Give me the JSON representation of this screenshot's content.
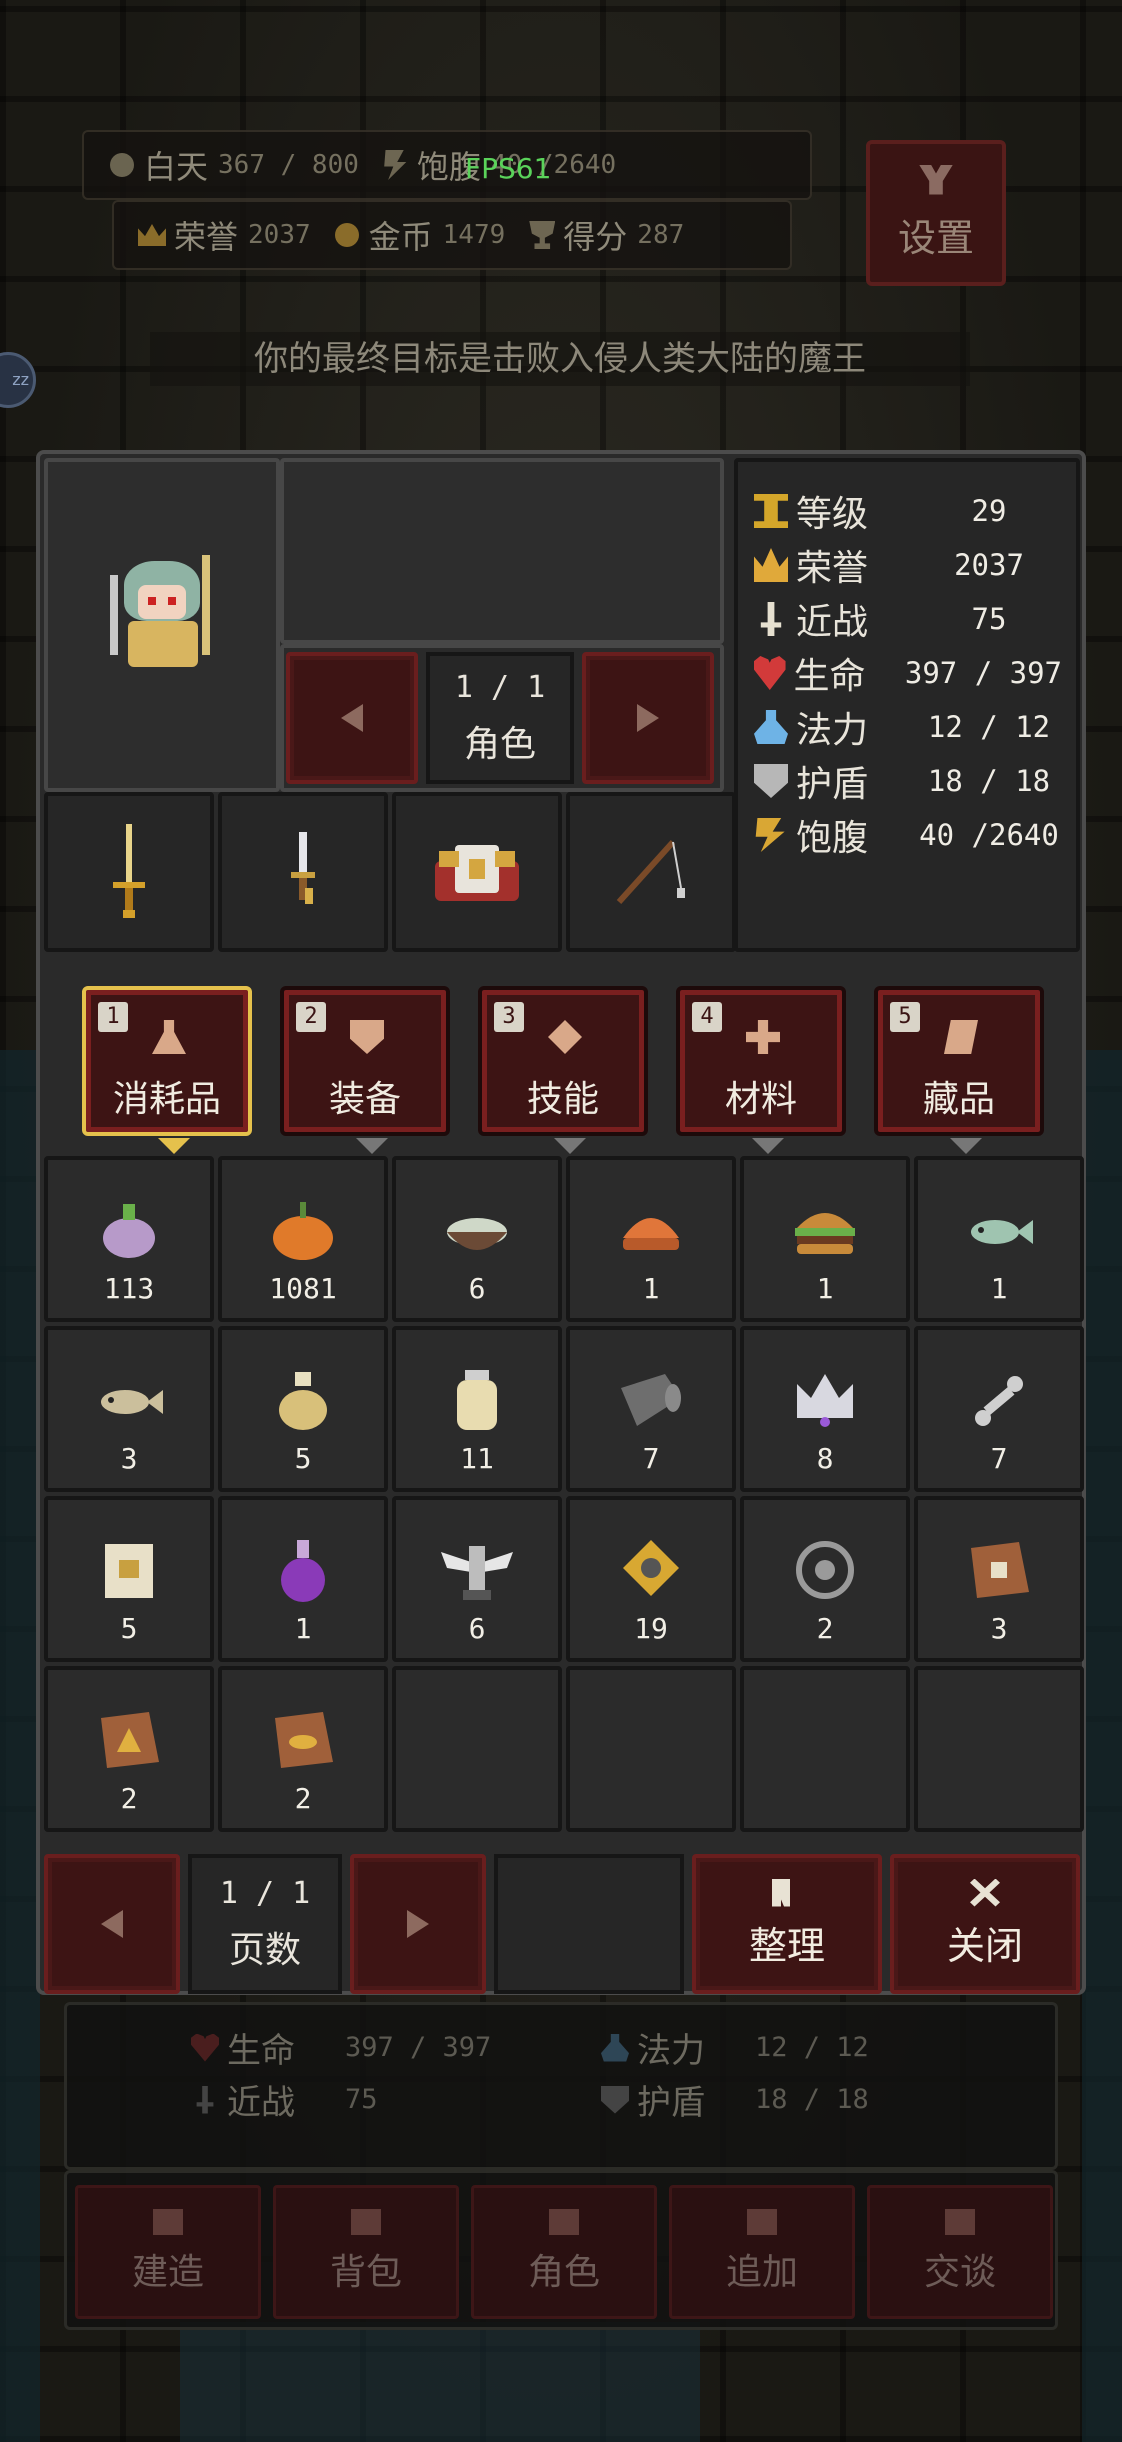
{
  "hud": {
    "day_label": "白天",
    "day_value": "367 / 800",
    "hunger_label": "饱腹",
    "hunger_value": "40 /2640",
    "fps": "FPS61",
    "honor_label": "荣誉",
    "honor_value": "2037",
    "gold_label": "金币",
    "gold_value": "1479",
    "score_label": "得分",
    "score_value": "287",
    "settings_label": "设置",
    "goal_text": "你的最终目标是击败入侵人类大陆的魔王",
    "sleep_badge": "zz"
  },
  "character_panel": {
    "page_indicator": "1  /  1",
    "page_label": "角色",
    "equipment": [
      "golden-sword-icon",
      "dagger-icon",
      "armor-icon",
      "fishing-rod-icon"
    ],
    "stats": [
      {
        "icon": "level-icon",
        "label": "等级",
        "value": "29"
      },
      {
        "icon": "honor-icon",
        "label": "荣誉",
        "value": "2037"
      },
      {
        "icon": "melee-icon",
        "label": "近战",
        "value": "75"
      },
      {
        "icon": "health-icon",
        "label": "生命",
        "value": "397 / 397"
      },
      {
        "icon": "mana-icon",
        "label": "法力",
        "value": "12  /  12"
      },
      {
        "icon": "shield-icon",
        "label": "护盾",
        "value": "18  /  18"
      },
      {
        "icon": "hunger-icon",
        "label": "饱腹",
        "value": "40 /2640"
      }
    ]
  },
  "tabs": [
    {
      "num": "1",
      "label": "消耗品",
      "active": true
    },
    {
      "num": "2",
      "label": "装备",
      "active": false
    },
    {
      "num": "3",
      "label": "技能",
      "active": false
    },
    {
      "num": "4",
      "label": "材料",
      "active": false
    },
    {
      "num": "5",
      "label": "藏品",
      "active": false
    }
  ],
  "inventory": [
    {
      "icon": "turnip-icon",
      "qty": "113",
      "color": "#b79ac9"
    },
    {
      "icon": "pumpkin-icon",
      "qty": "1081",
      "color": "#e07a2a"
    },
    {
      "icon": "soup-bowl-icon",
      "qty": "6",
      "color": "#6b4a36"
    },
    {
      "icon": "bun-icon",
      "qty": "1",
      "color": "#e0763a"
    },
    {
      "icon": "burger-icon",
      "qty": "1",
      "color": "#c88a3a"
    },
    {
      "icon": "fish-icon",
      "qty": "1",
      "color": "#9fc4b0"
    },
    {
      "icon": "dried-fish-icon",
      "qty": "3",
      "color": "#cbbf9c"
    },
    {
      "icon": "oil-jar-icon",
      "qty": "5",
      "color": "#d8c07a"
    },
    {
      "icon": "milk-jar-icon",
      "qty": "11",
      "color": "#e8dcb0"
    },
    {
      "icon": "cloth-roll-icon",
      "qty": "7",
      "color": "#6e6e6e"
    },
    {
      "icon": "crown-icon",
      "qty": "8",
      "color": "#d8d8e0"
    },
    {
      "icon": "bone-icon",
      "qty": "7",
      "color": "#cfcfcf"
    },
    {
      "icon": "house-scroll-icon",
      "qty": "5",
      "color": "#e8e0c8"
    },
    {
      "icon": "purple-potion-icon",
      "qty": "1",
      "color": "#8a3ab8"
    },
    {
      "icon": "winged-totem-icon",
      "qty": "6",
      "color": "#e6e6e6"
    },
    {
      "icon": "gold-emblem-icon",
      "qty": "19",
      "color": "#d8a832"
    },
    {
      "icon": "target-ring-icon",
      "qty": "2",
      "color": "#9a9a9a"
    },
    {
      "icon": "house-map-icon",
      "qty": "3",
      "color": "#a0603a"
    },
    {
      "icon": "triangle-map-icon",
      "qty": "2",
      "color": "#a0603a"
    },
    {
      "icon": "fish-map-icon",
      "qty": "2",
      "color": "#a0603a"
    },
    {
      "icon": "",
      "qty": "",
      "color": ""
    },
    {
      "icon": "",
      "qty": "",
      "color": ""
    },
    {
      "icon": "",
      "qty": "",
      "color": ""
    },
    {
      "icon": "",
      "qty": "",
      "color": ""
    }
  ],
  "inventory_pager": {
    "page_indicator": "1  /  1",
    "page_label": "页数",
    "sort_label": "整理",
    "close_label": "关闭"
  },
  "bottom_stats": {
    "hp_label": "生命",
    "hp_value": "397 / 397",
    "mp_label": "法力",
    "mp_value": "12  /  12",
    "melee_label": "近战",
    "melee_value": "75",
    "shield_label": "护盾",
    "shield_value": "18  /  18"
  },
  "bottom_menu": [
    {
      "label": "建造"
    },
    {
      "label": "背包"
    },
    {
      "label": "角色"
    },
    {
      "label": "追加"
    },
    {
      "label": "交谈"
    }
  ],
  "colors": {
    "accent_red": "#6a1e1e",
    "tab_active": "#e5c14c",
    "fps_green": "#5ad35a"
  }
}
